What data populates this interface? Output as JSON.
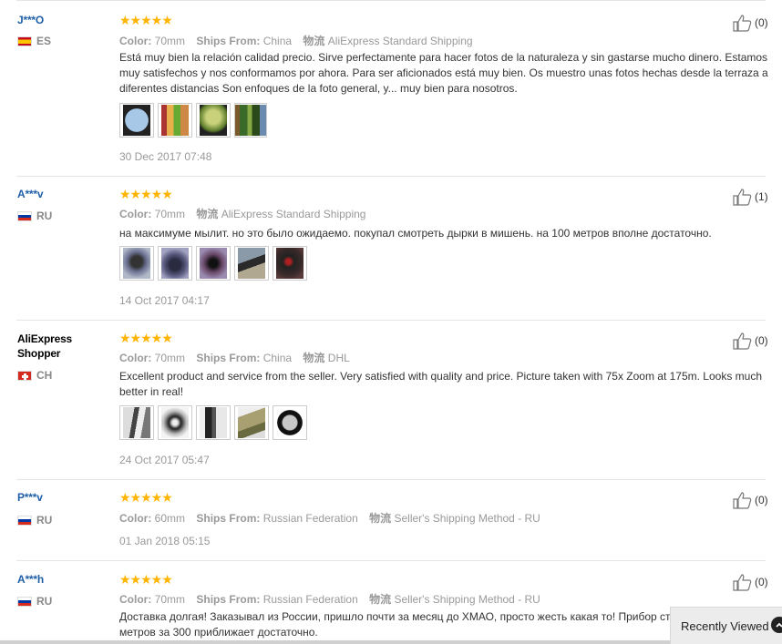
{
  "labels": {
    "color": "Color:",
    "ships_from": "Ships From:",
    "logistics": "物流",
    "stars": "★★★★★"
  },
  "reviews": [
    {
      "user": "J***O",
      "country": "ES",
      "color": "70mm",
      "ships_from": "China",
      "shipping": "AliExpress Standard Shipping",
      "text": "Está muy bien la relación calidad precio. Sirve perfectamente para hacer fotos de la naturaleza y sin gastarse mucho dinero. Estamos muy satisfechos y nos conformamos por ahora. Para ser aficionados está muy bien. Os muestro unas fotos hechas desde la terraza a diferentes distancias Son enfoques de la foto general, y... muy bien para nosotros.",
      "date": "30 Dec 2017 07:48",
      "helpful": "(0)"
    },
    {
      "user": "A***v",
      "country": "RU",
      "color": "70mm",
      "shipping": "AliExpress Standard Shipping",
      "text": "на максимуме мылит. но это было ожидаемо. покупал смотреть дырки в мишень. на 100 метров вполне достаточно.",
      "date": "14 Oct 2017 04:17",
      "helpful": "(1)"
    },
    {
      "user": "AliExpress Shopper",
      "country": "CH",
      "color": "70mm",
      "ships_from": "China",
      "shipping": "DHL",
      "text": "Excellent product and service from the seller. Very satisfied with quality and price. Picture taken with 75x Zoom at 175m. Looks much better in real!",
      "date": "24 Oct 2017 05:47",
      "helpful": "(0)"
    },
    {
      "user": "P***v",
      "country": "RU",
      "color": "60mm",
      "ships_from": "Russian Federation",
      "shipping": "Seller's Shipping Method - RU",
      "date": "01 Jan 2018 05:15",
      "helpful": "(0)"
    },
    {
      "user": "A***h",
      "country": "RU",
      "color": "70mm",
      "ships_from": "Russian Federation",
      "shipping": "Seller's Shipping Method - RU",
      "text": "Доставка долгая! Заказывал из России, пришло почти за месяц до ХМАО, просто жесть какая то! Прибор ст метров за 300 приближает достаточно.",
      "helpful": "(0)"
    }
  ],
  "recently_viewed": "Recently Viewed",
  "colors": {
    "link": "#1f5fa8",
    "star": "#ffb400",
    "muted": "#999999"
  }
}
